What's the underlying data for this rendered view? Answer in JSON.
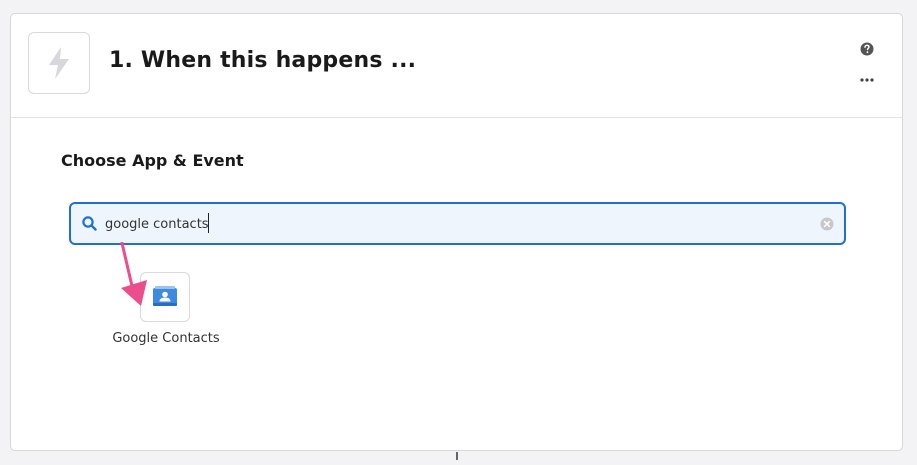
{
  "step": {
    "title": "1. When this happens ...",
    "app_icon": "lightning-bolt-icon"
  },
  "header_actions": {
    "help_icon": "question-mark-circle-icon",
    "more_icon": "ellipsis-icon"
  },
  "section": {
    "title": "Choose App & Event"
  },
  "search": {
    "value": "google contacts",
    "icon": "magnifier-icon",
    "clear_icon": "clear-circle-icon"
  },
  "results": [
    {
      "label": "Google Contacts",
      "icon": "google-contacts-icon"
    }
  ],
  "colors": {
    "accent": "#1e6fd9",
    "search_bg": "#eef5fd",
    "arrow": "#ec4d8c",
    "contacts_blue": "#3d8ae0"
  }
}
